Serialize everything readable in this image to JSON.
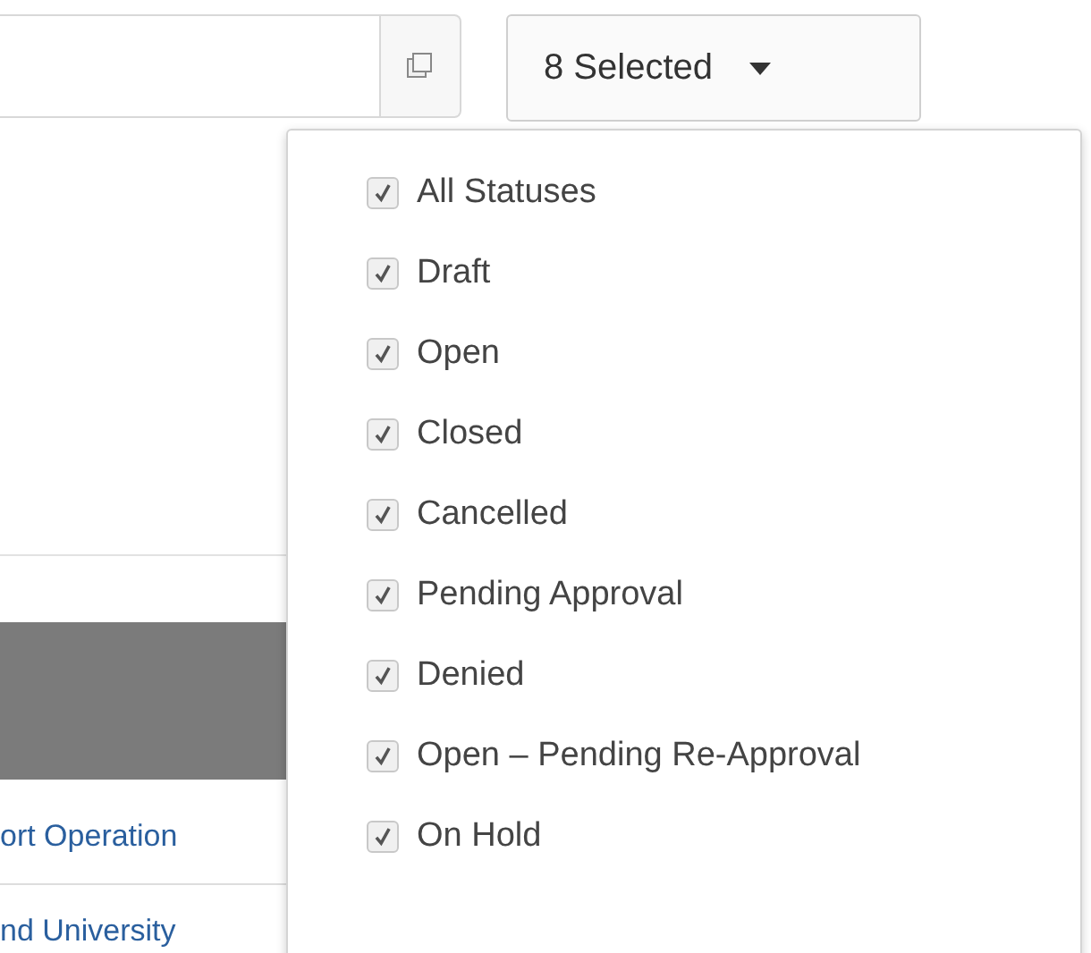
{
  "toolbar": {
    "filter_button": {
      "label": "8 Selected"
    }
  },
  "status_menu": {
    "items": [
      {
        "label": "All Statuses",
        "checked": true
      },
      {
        "label": "Draft",
        "checked": true
      },
      {
        "label": "Open",
        "checked": true
      },
      {
        "label": "Closed",
        "checked": true
      },
      {
        "label": "Cancelled",
        "checked": true
      },
      {
        "label": "Pending Approval",
        "checked": true
      },
      {
        "label": "Denied",
        "checked": true
      },
      {
        "label": "Open – Pending Re-Approval",
        "checked": true
      },
      {
        "label": "On Hold",
        "checked": true
      }
    ]
  },
  "table": {
    "rows": [
      {
        "cell": "ort Operation"
      },
      {
        "cell": "nd University"
      }
    ]
  }
}
